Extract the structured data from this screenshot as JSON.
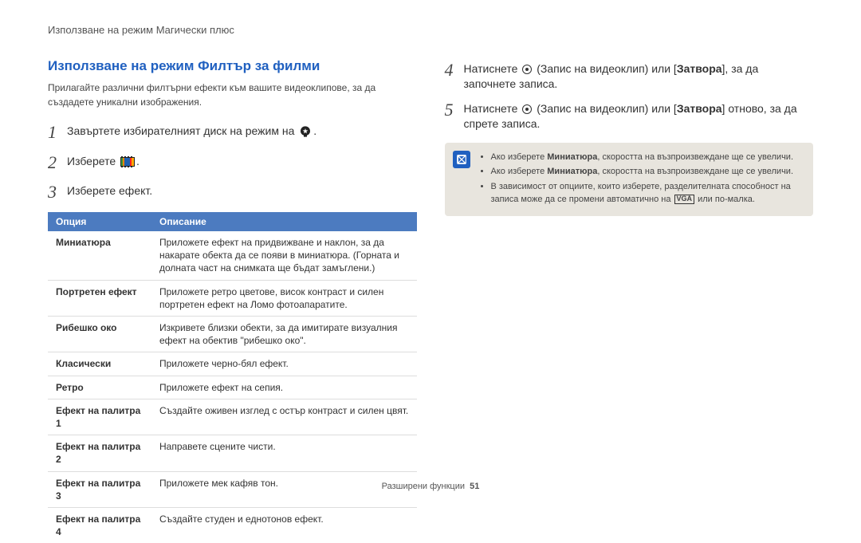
{
  "header": {
    "title": "Използване на режим Магически плюс"
  },
  "section": {
    "title": "Използване на режим Филтър за филми",
    "intro": "Прилагайте различни филтърни ефекти към вашите видеоклипове, за да създадете уникални изображения."
  },
  "steps": {
    "s1": {
      "num": "1",
      "text": "Завъртете избирателният диск на режим на"
    },
    "s2": {
      "num": "2",
      "text": "Изберете"
    },
    "s3": {
      "num": "3",
      "text": "Изберете ефект."
    },
    "s4": {
      "num": "4",
      "pre": "Натиснете",
      "mid1": "(Запис на видеоклип) или [",
      "bold": "Затвора",
      "mid2": "], за да започнете записа."
    },
    "s5": {
      "num": "5",
      "pre": "Натиснете",
      "mid1": "(Запис на видеоклип) или [",
      "bold": "Затвора",
      "mid2": "] отново, за да спрете записа."
    }
  },
  "table": {
    "headers": {
      "option": "Опция",
      "desc": "Описание"
    },
    "rows": [
      {
        "option": "Миниатюра",
        "desc": "Приложете ефект на придвижване и наклон, за да накарате обекта да се появи в миниатюра. (Горната и долната част на снимката ще бъдат замъглени.)"
      },
      {
        "option": "Портретен ефект",
        "desc": "Приложете ретро цветове, висок контраст и силен портретен ефект на Ломо фотоапаратите."
      },
      {
        "option": "Рибешко око",
        "desc": "Изкривете близки обекти, за да имитирате визуалния ефект на обектив \"рибешко око\"."
      },
      {
        "option": "Класически",
        "desc": "Приложете черно-бял ефект."
      },
      {
        "option": "Ретро",
        "desc": "Приложете ефект на сепия."
      },
      {
        "option": "Ефект на палитра 1",
        "desc": "Създайте оживен изглед с остър контраст и силен цвят."
      },
      {
        "option": "Ефект на палитра 2",
        "desc": "Направете сцените чисти."
      },
      {
        "option": "Ефект на палитра 3",
        "desc": "Приложете мек кафяв тон."
      },
      {
        "option": "Ефект на палитра 4",
        "desc": "Създайте студен и еднотонов ефект."
      }
    ]
  },
  "note": {
    "bullets": [
      {
        "pre": "Ако изберете ",
        "bold": "Миниатюра",
        "post": ", скоростта на възпроизвеждане ще се увеличи."
      },
      {
        "pre": "Ако изберете ",
        "bold": "Миниатюра",
        "post": ", скоростта на възпроизвеждане ще се увеличи."
      }
    ],
    "bullet3_pre": "В зависимост от опциите, които изберете, разделителната способност на записа може да се промени автоматично на ",
    "bullet3_vga": "VGA",
    "bullet3_post": " или по-малка."
  },
  "footer": {
    "text": "Разширени функции",
    "page": "51"
  }
}
